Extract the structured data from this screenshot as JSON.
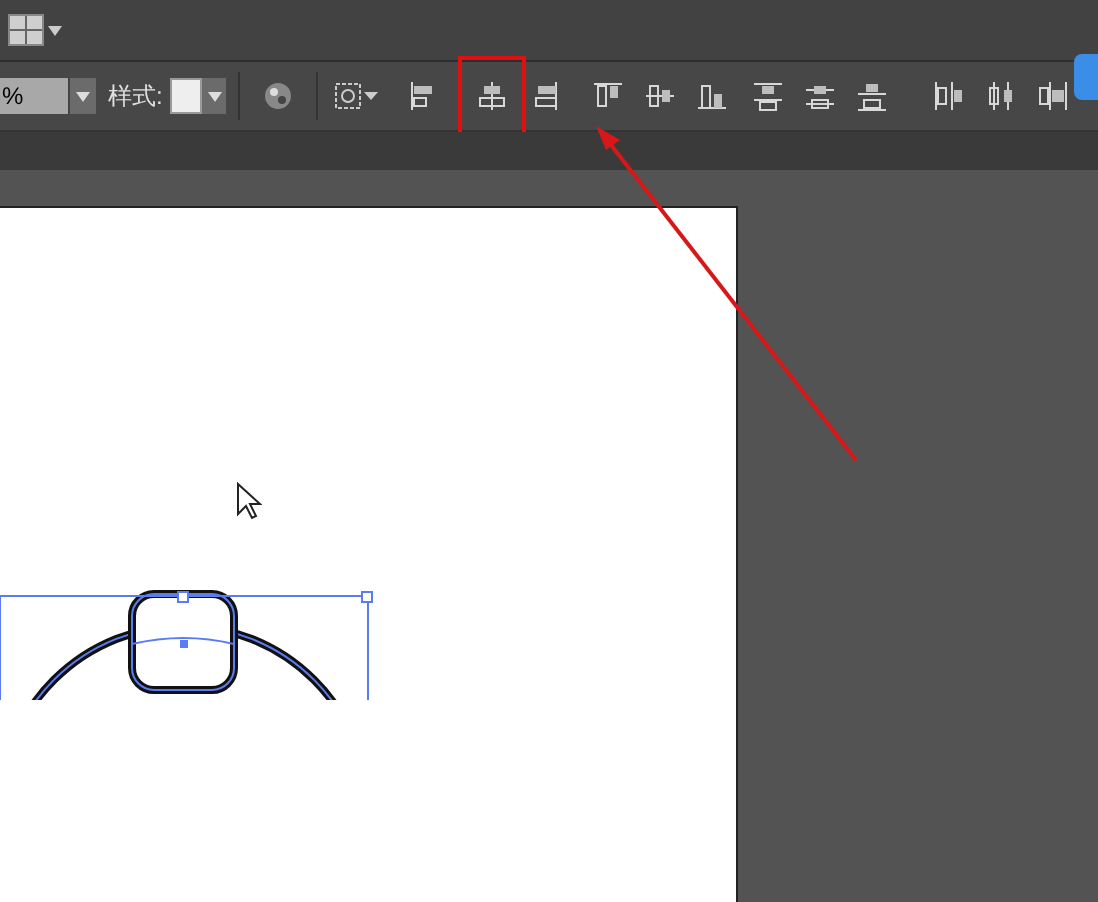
{
  "control_bar": {
    "opacity_value": "%",
    "style_label": "样式:"
  },
  "align_buttons": [
    {
      "kind": "left",
      "annotated": false
    },
    {
      "kind": "hcenter",
      "annotated": true
    },
    {
      "kind": "right",
      "annotated": false
    },
    {
      "kind": "top",
      "annotated": false
    },
    {
      "kind": "vcenter",
      "annotated": false
    },
    {
      "kind": "bottom",
      "annotated": false
    },
    {
      "kind": "dtop",
      "annotated": false
    },
    {
      "kind": "dvcenter",
      "annotated": false
    },
    {
      "kind": "dbottom",
      "annotated": false
    },
    {
      "kind": "dleft",
      "annotated": false
    },
    {
      "kind": "dhcenter",
      "annotated": false
    },
    {
      "kind": "dright",
      "annotated": false
    }
  ]
}
